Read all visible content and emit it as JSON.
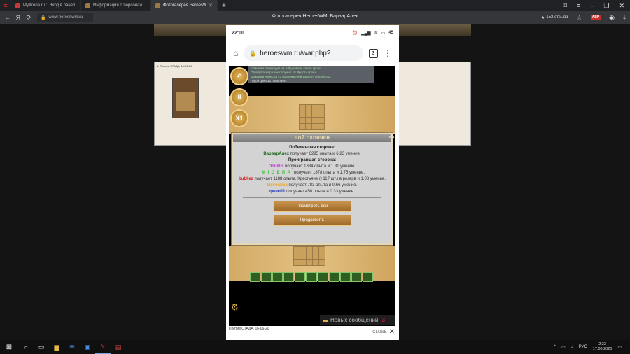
{
  "browser": {
    "tabs": [
      {
        "label": "MyArena.ru :: Вход в панел",
        "color": "#c43b3b"
      },
      {
        "label": "Информация о персонаж",
        "color": "#9a7a45"
      },
      {
        "label": "Фотогалерея HeroesWM. В",
        "color": "#9a7a45"
      }
    ],
    "url": "www.heroeswm.ru",
    "title": "Фотогалерея HeroesWM. ВарварАлех",
    "reviews": "153 отзыва",
    "adblock": "ABP"
  },
  "phone": {
    "time": "22:00",
    "battery": "45",
    "url": "heroeswm.ru/war.php?",
    "tabs_count": "3"
  },
  "game": {
    "log": [
      "Шаманка переходит на 2-й уровень Гнева крови.",
      "Отряд ВарварАлех получил 18 Ярости крови.",
      "Шаманка нанесла 41 повреждений Дракон. Погибло 2.",
      "Герой qwert11 повержен."
    ],
    "buttons": [
      "↶",
      "II",
      "X1"
    ],
    "messages_label": "Новых сообщений:",
    "messages_count": "3"
  },
  "dialog": {
    "title": "БОЙ ОКОНЧЕН",
    "winners_header": "Победившая сторона:",
    "winners": [
      {
        "name": "ВарварАлех",
        "text": "получает 6295 опыта и 6.23 умение.",
        "color": "#1f6a1f"
      }
    ],
    "losers_header": "Проигравшая сторона:",
    "losers": [
      {
        "name": "Donillis",
        "text": "получает 1834 опыта и 1.81 умение.",
        "color": "#c02fd6"
      },
      {
        "name": "_M_I_G_E_R_A_",
        "text": "получает 1878 опыта и 1.75 умение.",
        "color": "#3fc03f"
      },
      {
        "name": "bubkez",
        "text": "получает 1188 опыта, Крестьяне (+117 шт.) в резерв и 1.08 умение.",
        "color": "#d12020"
      },
      {
        "name": "Devorama",
        "text": "получает 783 опыта и 0.66 умение.",
        "color": "#e8a628"
      },
      {
        "name": "qwert11",
        "text": "получает 450 опыта и 0.33 умение.",
        "color": "#1a2fb8"
      }
    ],
    "view_battle": "Посмотреть бой",
    "continue": "Продолжить"
  },
  "lightbox": {
    "caption": "Против СТАДА, 16-06-20",
    "close": "CLOSE"
  },
  "page": {
    "panel_caption": "1. Против СТАДА, 16-06-20"
  },
  "taskbar": {
    "lang": "РУС",
    "time": "2:33",
    "date": "17.06.2020"
  }
}
